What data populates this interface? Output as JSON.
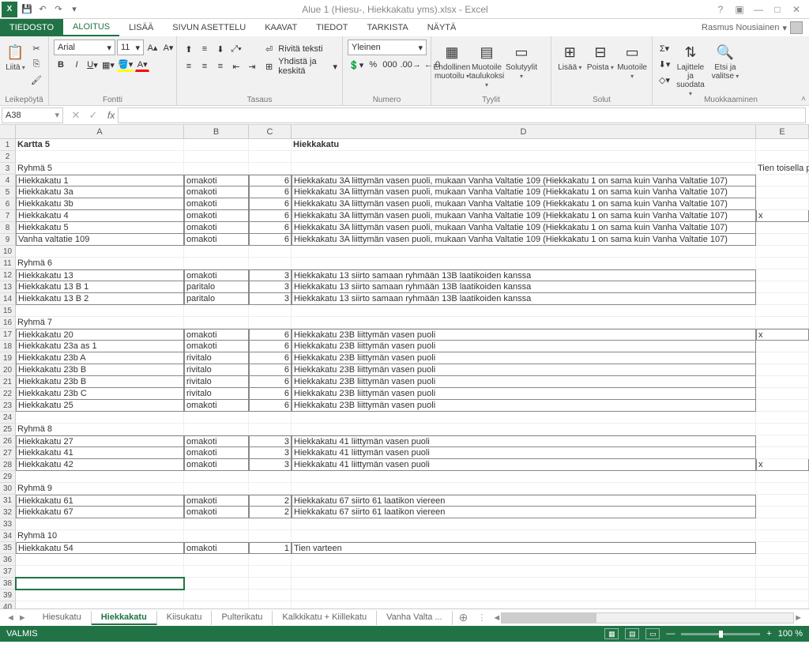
{
  "title": "Alue 1 (Hiesu-, Hiekkakatu yms).xlsx - Excel",
  "user": "Rasmus Nousiainen",
  "quickAccess": {
    "save": "💾",
    "undo": "↶",
    "redo": "↷"
  },
  "menu": {
    "tiedosto": "TIEDOSTO",
    "aloitus": "ALOITUS",
    "lisaa": "LISÄÄ",
    "sivun": "SIVUN ASETTELU",
    "kaavat": "KAAVAT",
    "tiedot": "TIEDOT",
    "tarkista": "TARKISTA",
    "nayta": "NÄYTÄ"
  },
  "ribbon": {
    "leikepoyra": {
      "label": "Leikepöytä",
      "liita": "Liitä"
    },
    "fontti": {
      "label": "Fontti",
      "name": "Arial",
      "size": "11"
    },
    "tasaus": {
      "label": "Tasaus",
      "rivita": "Rivitä teksti",
      "yhdista": "Yhdistä ja keskitä"
    },
    "numero": {
      "label": "Numero",
      "format": "Yleinen"
    },
    "tyylit": {
      "label": "Tyylit",
      "ehdollinen": "Ehdollinen muotoilu",
      "muotoile": "Muotoile taulukoksi",
      "solutyylit": "Solutyylit"
    },
    "solut": {
      "label": "Solut",
      "lisaa": "Lisää",
      "poista": "Poista",
      "muotoile": "Muotoile"
    },
    "muokkaaminen": {
      "label": "Muokkaaminen",
      "lajittele": "Lajittele ja suodata",
      "etsi": "Etsi ja valitse"
    }
  },
  "namebox": "A38",
  "columns": [
    "A",
    "B",
    "C",
    "D",
    "E"
  ],
  "tabs": {
    "nav_prev": "◄",
    "nav_next": "►",
    "items": [
      "Hiesukatu",
      "Hiekkakatu",
      "Kiisukatu",
      "Pulterikatu",
      "Kalkkikatu + Kiillekatu",
      "Vanha Valta ..."
    ],
    "active": 1,
    "add": "⊕"
  },
  "status": {
    "ready": "VALMIS",
    "zoom": "100 %"
  },
  "chart_data": {
    "type": "table",
    "title_row": {
      "A": "Kartta 5",
      "D": "Hiekkakatu"
    },
    "header_E": "Tien toisella p",
    "rows": [
      {
        "r": 1,
        "A": "Kartta 5",
        "D": "Hiekkakatu",
        "bold": true
      },
      {
        "r": 2
      },
      {
        "r": 3,
        "A": "Ryhmä 5",
        "E": "Tien toisella p"
      },
      {
        "r": 4,
        "A": "Hiekkakatu 1",
        "B": "omakoti",
        "C": 6,
        "D": "Hiekkakatu 3A liittymän vasen puoli, mukaan Vanha Valtatie 109 (Hiekkakatu 1 on sama kuin Vanha Valtatie 107)",
        "box": true,
        "boxtop": true
      },
      {
        "r": 5,
        "A": "Hiekkakatu 3a",
        "B": "omakoti",
        "C": 6,
        "D": "Hiekkakatu 3A liittymän vasen puoli, mukaan Vanha Valtatie 109 (Hiekkakatu 1 on sama kuin Vanha Valtatie 107)",
        "box": true
      },
      {
        "r": 6,
        "A": "Hiekkakatu 3b",
        "B": "omakoti",
        "C": 6,
        "D": "Hiekkakatu 3A liittymän vasen puoli, mukaan Vanha Valtatie 109 (Hiekkakatu 1 on sama kuin Vanha Valtatie 107)",
        "box": true
      },
      {
        "r": 7,
        "A": "Hiekkakatu 4",
        "B": "omakoti",
        "C": 6,
        "D": "Hiekkakatu 3A liittymän vasen puoli, mukaan Vanha Valtatie 109 (Hiekkakatu 1 on sama kuin Vanha Valtatie 107)",
        "E": "x",
        "box": true
      },
      {
        "r": 8,
        "A": "Hiekkakatu 5",
        "B": "omakoti",
        "C": 6,
        "D": "Hiekkakatu 3A liittymän vasen puoli, mukaan Vanha Valtatie 109 (Hiekkakatu 1 on sama kuin Vanha Valtatie 107)",
        "box": true
      },
      {
        "r": 9,
        "A": "Vanha valtatie 109",
        "B": "omakoti",
        "C": 6,
        "D": "Hiekkakatu 3A liittymän vasen puoli, mukaan Vanha Valtatie 109 (Hiekkakatu 1 on sama kuin Vanha Valtatie 107)",
        "box": true
      },
      {
        "r": 10
      },
      {
        "r": 11,
        "A": "Ryhmä 6"
      },
      {
        "r": 12,
        "A": "Hiekkakatu 13",
        "B": "omakoti",
        "C": 3,
        "D": "Hiekkakatu 13 siirto samaan ryhmään 13B laatikoiden kanssa",
        "box": true,
        "boxtop": true
      },
      {
        "r": 13,
        "A": "Hiekkakatu 13 B 1",
        "B": "paritalo",
        "C": 3,
        "D": "Hiekkakatu 13 siirto samaan ryhmään 13B laatikoiden kanssa",
        "box": true
      },
      {
        "r": 14,
        "A": "Hiekkakatu 13 B 2",
        "B": "paritalo",
        "C": 3,
        "D": "Hiekkakatu 13 siirto samaan ryhmään 13B laatikoiden kanssa",
        "box": true
      },
      {
        "r": 15
      },
      {
        "r": 16,
        "A": "Ryhmä 7"
      },
      {
        "r": 17,
        "A": "Hiekkakatu 20",
        "B": "omakoti",
        "C": 6,
        "D": "Hiekkakatu 23B liittymän vasen puoli",
        "E": "x",
        "box": true,
        "boxtop": true
      },
      {
        "r": 18,
        "A": "Hiekkakatu 23a as 1",
        "B": "omakoti",
        "C": 6,
        "D": "Hiekkakatu 23B liittymän vasen puoli",
        "box": true
      },
      {
        "r": 19,
        "A": "Hiekkakatu 23b A",
        "B": "rivitalo",
        "C": 6,
        "D": "Hiekkakatu 23B liittymän vasen puoli",
        "box": true
      },
      {
        "r": 20,
        "A": "Hiekkakatu 23b B",
        "B": "rivitalo",
        "C": 6,
        "D": "Hiekkakatu 23B liittymän vasen puoli",
        "box": true
      },
      {
        "r": 21,
        "A": "Hiekkakatu 23b B",
        "B": "rivitalo",
        "C": 6,
        "D": "Hiekkakatu 23B liittymän vasen puoli",
        "box": true
      },
      {
        "r": 22,
        "A": "Hiekkakatu 23b C",
        "B": "rivitalo",
        "C": 6,
        "D": "Hiekkakatu 23B liittymän vasen puoli",
        "box": true
      },
      {
        "r": 23,
        "A": "Hiekkakatu 25",
        "B": "omakoti",
        "C": 6,
        "D": "Hiekkakatu 23B liittymän vasen puoli",
        "box": true
      },
      {
        "r": 24
      },
      {
        "r": 25,
        "A": "Ryhmä 8"
      },
      {
        "r": 26,
        "A": "Hiekkakatu 27",
        "B": "omakoti",
        "C": 3,
        "D": "Hiekkakatu 41 liittymän vasen puoli",
        "box": true,
        "boxtop": true
      },
      {
        "r": 27,
        "A": "Hiekkakatu 41",
        "B": "omakoti",
        "C": 3,
        "D": "Hiekkakatu 41 liittymän vasen puoli",
        "box": true
      },
      {
        "r": 28,
        "A": "Hiekkakatu 42",
        "B": "omakoti",
        "C": 3,
        "D": "Hiekkakatu 41 liittymän vasen puoli",
        "E": "x",
        "box": true
      },
      {
        "r": 29
      },
      {
        "r": 30,
        "A": "Ryhmä 9"
      },
      {
        "r": 31,
        "A": "Hiekkakatu 61",
        "B": "omakoti",
        "C": 2,
        "D": "Hiekkakatu 67 siirto 61 laatikon viereen",
        "box": true,
        "boxtop": true
      },
      {
        "r": 32,
        "A": "Hiekkakatu 67",
        "B": "omakoti",
        "C": 2,
        "D": "Hiekkakatu 67 siirto 61 laatikon viereen",
        "box": true
      },
      {
        "r": 33
      },
      {
        "r": 34,
        "A": "Ryhmä 10"
      },
      {
        "r": 35,
        "A": "Hiekkakatu 54",
        "B": "omakoti",
        "C": 1,
        "D": "Tien varteen",
        "box": true,
        "boxtop": true
      },
      {
        "r": 36
      },
      {
        "r": 37
      },
      {
        "r": 38,
        "selected": true
      },
      {
        "r": 39
      },
      {
        "r": 40
      }
    ]
  }
}
